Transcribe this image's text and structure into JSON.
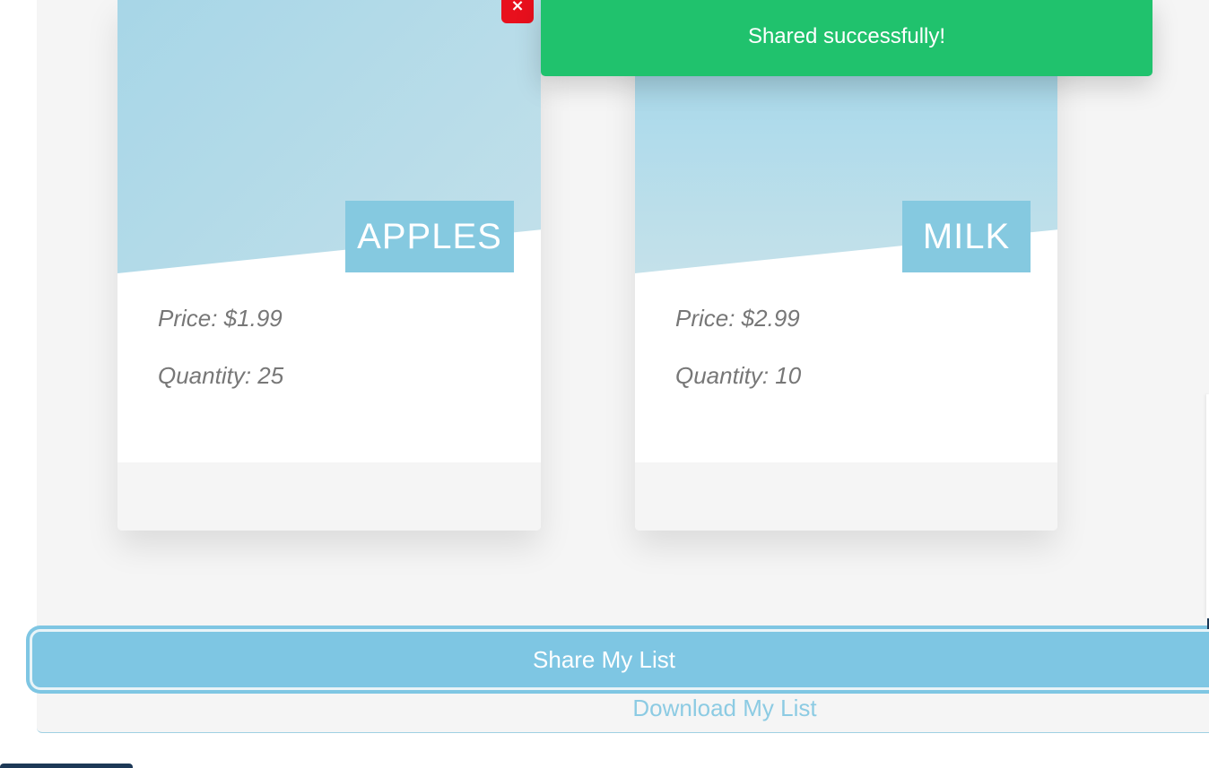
{
  "toast": {
    "message": "Shared successfully!",
    "color": "#20c26d"
  },
  "remove_button": {
    "label": "×",
    "color": "#e8101d"
  },
  "items": [
    {
      "name": "APPLES",
      "price": "Price: $1.99",
      "quantity": "Quantity: 25"
    },
    {
      "name": "MILK",
      "price": "Price: $2.99",
      "quantity": "Quantity: 10"
    }
  ],
  "actions": {
    "share_label": "Share My List",
    "download_label": "Download My List",
    "accent_color": "#7ec6e3"
  }
}
